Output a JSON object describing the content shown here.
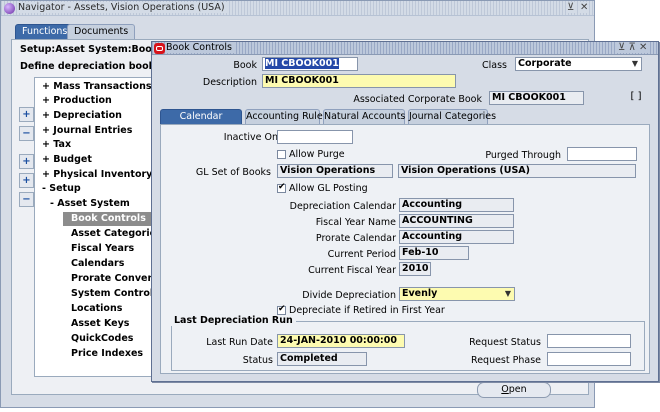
{
  "navigator": {
    "title": "Navigator - Assets, Vision Operations (USA)",
    "controls": [
      "⊻",
      "✕"
    ],
    "tabs": [
      "Functions",
      "Documents"
    ],
    "setup_path": "Setup:Asset System:Book Contro",
    "description": "Define depreciation books",
    "tree": [
      {
        "prefix": "+",
        "label": "Mass Transactions"
      },
      {
        "prefix": "+",
        "label": "Production"
      },
      {
        "prefix": "+",
        "label": "Depreciation"
      },
      {
        "prefix": "+",
        "label": "Journal Entries"
      },
      {
        "prefix": "+",
        "label": "Tax"
      },
      {
        "prefix": "+",
        "label": "Budget"
      },
      {
        "prefix": "+",
        "label": "Physical Inventory"
      },
      {
        "prefix": "-",
        "label": "Setup"
      },
      {
        "prefix": "-",
        "label": "Asset System"
      },
      {
        "prefix": "",
        "label": "Book Controls"
      },
      {
        "prefix": "",
        "label": "Asset Categories"
      },
      {
        "prefix": "",
        "label": "Fiscal Years"
      },
      {
        "prefix": "",
        "label": "Calendars"
      },
      {
        "prefix": "",
        "label": "Prorate Convention"
      },
      {
        "prefix": "",
        "label": "System Controls"
      },
      {
        "prefix": "",
        "label": "Locations"
      },
      {
        "prefix": "",
        "label": "Asset Keys"
      },
      {
        "prefix": "",
        "label": "QuickCodes"
      },
      {
        "prefix": "",
        "label": "Price Indexes"
      }
    ],
    "side_buttons": [
      "+",
      "−",
      "+",
      "+",
      "−"
    ],
    "open_button": "Open",
    "open_mnemonic": "O",
    "open_rest": "pen"
  },
  "book_controls": {
    "title": "Book Controls",
    "window_controls": "⊻ ⊼ ✕",
    "book_label": "Book",
    "book_value": "MI CBOOK001",
    "class_label": "Class",
    "class_value": "Corporate",
    "description_label": "Description",
    "description_value": "MI CBOOK001",
    "assoc_label": "Associated Corporate Book",
    "assoc_value": "MI CBOOK001",
    "bracket": "[ ]",
    "tabs": [
      "Calendar",
      "Accounting Rules",
      "Natural Accounts",
      "Journal Categories"
    ],
    "calendar": {
      "inactive_on_label": "Inactive On",
      "inactive_on_value": "",
      "allow_purge_label": "Allow Purge",
      "allow_purge": false,
      "purged_through_label": "Purged Through",
      "purged_through_value": "",
      "gl_sob_label": "GL Set of Books",
      "gl_sob_value": "Vision Operations",
      "gl_sob_desc": "Vision Operations (USA)",
      "allow_gl_posting_label": "Allow GL Posting",
      "allow_gl_posting": true,
      "dep_calendar_label": "Depreciation Calendar",
      "dep_calendar_value": "Accounting",
      "fiscal_year_name_label": "Fiscal Year Name",
      "fiscal_year_name_value": "ACCOUNTING",
      "prorate_calendar_label": "Prorate Calendar",
      "prorate_calendar_value": "Accounting",
      "current_period_label": "Current Period",
      "current_period_value": "Feb-10",
      "current_fiscal_year_label": "Current Fiscal Year",
      "current_fiscal_year_value": "2010",
      "divide_dep_label": "Divide Depreciation",
      "divide_dep_value": "Evenly",
      "dep_retired_label": "Depreciate if Retired in First Year",
      "dep_retired": true,
      "last_run_group": "Last Depreciation Run",
      "last_run_date_label": "Last Run Date",
      "last_run_date_value": "24-JAN-2010 00:00:00",
      "request_status_label": "Request Status",
      "request_status_value": "",
      "status_label": "Status",
      "status_value": "Completed",
      "request_phase_label": "Request Phase",
      "request_phase_value": ""
    }
  }
}
